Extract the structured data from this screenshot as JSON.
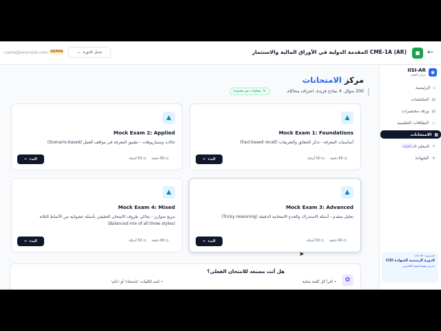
{
  "topbar": {
    "back_icon": "arrow-left-icon",
    "course_title": "CME-1A (AR) المقدمة الدولية في الأوراق المالية والاستثمار",
    "email": "name@example.com",
    "admin_badge": "ADMIN",
    "course_switch": "تبديل الدورة"
  },
  "sidebar": {
    "brand_name": "IISI-AR",
    "brand_sub": "مركز التعلم",
    "items": [
      {
        "label": "الرئيسية",
        "icon": "home-icon"
      },
      {
        "label": "الملخصات",
        "icon": "doc-icon"
      },
      {
        "label": "ورقة مختصرات",
        "icon": "sheet-icon"
      },
      {
        "label": "البطاقات التعليمية",
        "icon": "cards-icon"
      },
      {
        "label": "الامتحانات",
        "icon": "exam-icon"
      },
      {
        "label": "المعلم الذكي",
        "icon": "ai-icon"
      },
      {
        "label": "الشهادة",
        "icon": "certificate-icon"
      }
    ],
    "ai_badge": "تجريبي",
    "promo": {
      "small": "المستوى: CISI AR",
      "title": "الدورة الرسمية الشهادة CISI",
      "link": "اعرض موقع المعهد الإلكتروني"
    }
  },
  "main": {
    "title_pre": "مركز ",
    "title_accent": "الامتحانات",
    "subtitle": "200 سؤال. 4 نماذج فريدة. احتراف محاكاة.",
    "unlimited": "محاولات غير محدودة",
    "start_label": "البدء",
    "cards": [
      {
        "title": "Mock Exam 1: Foundations",
        "desc": "أساسيات المعرفة - تذكر الحقائق والتعريفات (Fact-based recall)",
        "questions": "50 أسئلة",
        "minutes": "60 دقيقة"
      },
      {
        "title": "Mock Exam 2: Applied",
        "desc": "حالات وسيناريوهات - تطبيق المعرفة في مواقف العمل (Scenario-based)",
        "questions": "50 أسئلة",
        "minutes": "60 دقيقة"
      },
      {
        "title": "Mock Exam 3: Advanced",
        "desc": "تحليل متقدم - أسئلة الاستدراك والخدع الامتحانية الدقيقة (Tricky reasoning)",
        "questions": "50 أسئلة",
        "minutes": "60 دقيقة"
      },
      {
        "title": "Mock Exam 4: Mixed",
        "desc": "مزيج متوازن - يحاكي ظروف الامتحان الحقيقي بأسئلة عشوائية من الأنماط الثلاثة (Balanced mix of all three styles)",
        "questions": "50 أسئلة",
        "minutes": "60 دقيقة"
      }
    ]
  },
  "tips": {
    "title": "هل أنت مستعد للامتحان الفعلي؟",
    "tip1": "اقرأ كل كلمة بعناية",
    "tip2": "انتبه لكلمات 'باستثناء' أو 'دائم'"
  }
}
